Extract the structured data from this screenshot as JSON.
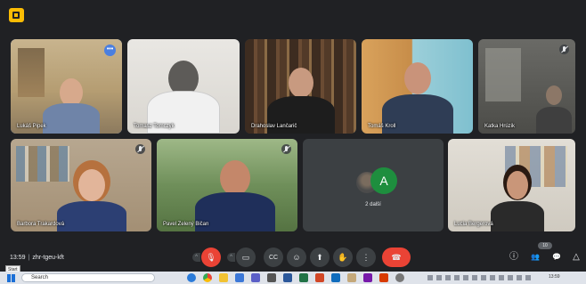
{
  "window": {
    "title": "Google Meet"
  },
  "tiles": [
    {
      "name": "Lukáš Pipek",
      "active": true,
      "more_label": "•••"
    },
    {
      "name": "Tomasz Tomczyk"
    },
    {
      "name": "Drahoslav Lančarič"
    },
    {
      "name": "Tomáš Kroll"
    },
    {
      "name": "Katka Hrúzik"
    },
    {
      "name": "Barbora Trakardová"
    },
    {
      "name": "Pavel Zelený Bičan"
    },
    {
      "name": "Lucia Bergerová"
    }
  ],
  "others": {
    "letter": "A",
    "label": "2 další"
  },
  "meeting": {
    "time": "13:59",
    "separator": "|",
    "code": "zhr-tgeu-kft"
  },
  "controls": [
    {
      "name": "mic-toggle",
      "glyph": "🎙"
    },
    {
      "name": "camera-toggle",
      "glyph": "▭"
    },
    {
      "name": "captions-toggle",
      "glyph": "CC"
    },
    {
      "name": "emoji-reactions",
      "glyph": "☺"
    },
    {
      "name": "present-screen",
      "glyph": "⬆"
    },
    {
      "name": "raise-hand",
      "glyph": "✋"
    },
    {
      "name": "more-options",
      "glyph": "⋮"
    },
    {
      "name": "leave-call",
      "glyph": "☎"
    }
  ],
  "right_panel": {
    "participants_count": "10",
    "info_glyph": "ⓘ",
    "people_glyph": "👥",
    "chat_glyph": "💬",
    "activities_glyph": "△"
  },
  "taskbar": {
    "tooltip": "Start",
    "search_placeholder": "Search",
    "tray_time": "13:59"
  },
  "colors": {
    "background": "#202124",
    "tile": "#3c4043",
    "accent_blue": "#8ab4f8",
    "danger_red": "#ea4335",
    "avatar_green": "#1e8e3e",
    "logo_yellow": "#fbbc04"
  }
}
